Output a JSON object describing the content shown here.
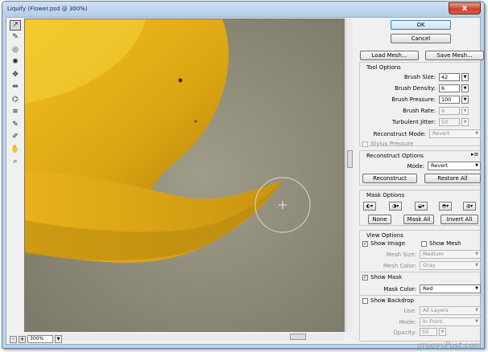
{
  "window": {
    "title": "Liquify (Flower.psd @ 300%)",
    "close_label": "x"
  },
  "tools": [
    {
      "name": "forward-warp-icon",
      "glyph": "↗"
    },
    {
      "name": "reconstruct-icon",
      "glyph": "✎"
    },
    {
      "name": "twirl-clockwise-icon",
      "glyph": "◎"
    },
    {
      "name": "pucker-icon",
      "glyph": "✺"
    },
    {
      "name": "bloat-icon",
      "glyph": "✥"
    },
    {
      "name": "push-left-icon",
      "glyph": "⇹"
    },
    {
      "name": "mirror-icon",
      "glyph": "⌬"
    },
    {
      "name": "turbulence-icon",
      "glyph": "≋"
    },
    {
      "name": "freeze-mask-icon",
      "glyph": "✎"
    },
    {
      "name": "thaw-mask-icon",
      "glyph": "✐"
    },
    {
      "name": "hand-icon",
      "glyph": "✋"
    },
    {
      "name": "zoom-icon",
      "glyph": "⌕"
    }
  ],
  "zoom": {
    "value": "300%",
    "minus": "-",
    "plus": "+"
  },
  "buttons": {
    "ok": "OK",
    "cancel": "Cancel",
    "load_mesh": "Load Mesh...",
    "save_mesh": "Save Mesh...",
    "reconstruct": "Reconstruct",
    "restore_all": "Restore All",
    "none": "None",
    "mask_all": "Mask All",
    "invert_all": "Invert All"
  },
  "tool_options": {
    "heading": "Tool Options",
    "brush_size_label": "Brush Size:",
    "brush_size": "42",
    "brush_density_label": "Brush Density:",
    "brush_density": "6",
    "brush_pressure_label": "Brush Pressure:",
    "brush_pressure": "100",
    "brush_rate_label": "Brush Rate:",
    "brush_rate": "6",
    "turbulent_jitter_label": "Turbulent Jitter:",
    "turbulent_jitter": "50",
    "reconstruct_mode_label": "Reconstruct Mode:",
    "reconstruct_mode": "Revert",
    "stylus_pressure_label": "Stylus Pressure"
  },
  "reconstruct_options": {
    "heading": "Reconstruct Options",
    "mode_label": "Mode:",
    "mode": "Revert"
  },
  "mask_options": {
    "heading": "Mask Options"
  },
  "view_options": {
    "heading": "View Options",
    "show_image_label": "Show Image",
    "show_mesh_label": "Show Mesh",
    "mesh_size_label": "Mesh Size:",
    "mesh_size": "Medium",
    "mesh_color_label": "Mesh Color:",
    "mesh_color": "Gray",
    "show_mask_label": "Show Mask",
    "mask_color_label": "Mask Color:",
    "mask_color": "Red",
    "show_backdrop_label": "Show Backdrop",
    "use_label": "Use:",
    "use": "All Layers",
    "mode_label": "Mode:",
    "mode": "In Front",
    "opacity_label": "Opacity:",
    "opacity": "50"
  },
  "watermark": "groovyPost.com",
  "colors": {
    "petal": "#e0a814",
    "background": "#8f8b7a",
    "accent": "#3c7fb1"
  }
}
